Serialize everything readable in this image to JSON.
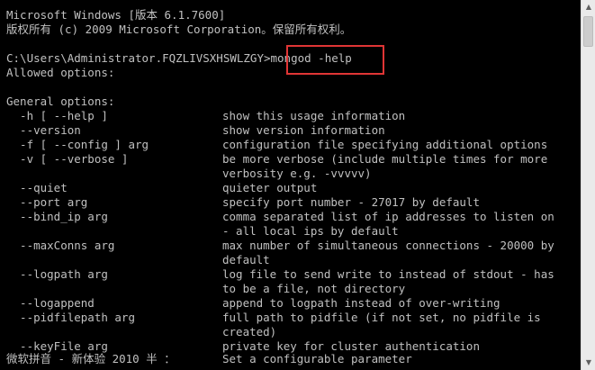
{
  "console": {
    "header_line1": "Microsoft Windows [版本 6.1.7600]",
    "header_line2": "版权所有 (c) 2009 Microsoft Corporation。保留所有权利。",
    "prompt": "C:\\Users\\Administrator.FQZLIVSXHSWLZGY>",
    "command": "mongod -help",
    "allowed_options": "Allowed options:",
    "general_options": "General options:",
    "options": [
      {
        "opt": "  -h [ --help ]",
        "desc": "show this usage information"
      },
      {
        "opt": "  --version",
        "desc": "show version information"
      },
      {
        "opt": "  -f [ --config ] arg",
        "desc": "configuration file specifying additional options"
      },
      {
        "opt": "  -v [ --verbose ]",
        "desc": "be more verbose (include multiple times for more"
      },
      {
        "opt": "",
        "desc": "verbosity e.g. -vvvvv)"
      },
      {
        "opt": "  --quiet",
        "desc": "quieter output"
      },
      {
        "opt": "  --port arg",
        "desc": "specify port number - 27017 by default"
      },
      {
        "opt": "  --bind_ip arg",
        "desc": "comma separated list of ip addresses to listen on"
      },
      {
        "opt": "",
        "desc": "- all local ips by default"
      },
      {
        "opt": "  --maxConns arg",
        "desc": "max number of simultaneous connections - 20000 by"
      },
      {
        "opt": "",
        "desc": "default"
      },
      {
        "opt": "  --logpath arg",
        "desc": "log file to send write to instead of stdout - has"
      },
      {
        "opt": "",
        "desc": "to be a file, not directory"
      },
      {
        "opt": "  --logappend",
        "desc": "append to logpath instead of over-writing"
      },
      {
        "opt": "  --pidfilepath arg",
        "desc": "full path to pidfile (if not set, no pidfile is"
      },
      {
        "opt": "",
        "desc": "created)"
      },
      {
        "opt": "  --keyFile arg",
        "desc": "private key for cluster authentication"
      }
    ],
    "ime_status": "微软拼音 - 新体验 2010 半 ：",
    "last_desc": "Set a configurable parameter"
  }
}
